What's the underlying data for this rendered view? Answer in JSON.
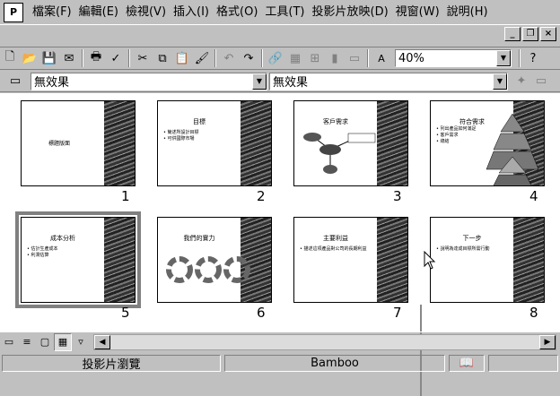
{
  "menubar": {
    "app_icon": "powerpoint-doc-icon",
    "items": [
      "檔案(F)",
      "編輯(E)",
      "檢視(V)",
      "插入(I)",
      "格式(O)",
      "工具(T)",
      "投影片放映(D)",
      "視窗(W)",
      "說明(H)"
    ]
  },
  "toolbar": {
    "zoom_value": "40%"
  },
  "effects": {
    "slide_transition": "無效果",
    "text_effect": "無效果"
  },
  "slides": [
    {
      "number": "1",
      "title": "",
      "body": [
        "標題版面"
      ],
      "footer": ""
    },
    {
      "number": "2",
      "title": "目標",
      "body": [
        "• 簡述所設計目標",
        "• 可供國際市場"
      ],
      "footer": ""
    },
    {
      "number": "3",
      "title": "客戶需求",
      "body": [],
      "footer": ""
    },
    {
      "number": "4",
      "title": "符合需求",
      "body": [
        "• 列出產品如何滿足",
        "• 客戶需求",
        "• 總結"
      ],
      "footer": ""
    },
    {
      "number": "5",
      "title": "成本分析",
      "body": [
        "• 估計生產成本",
        "• 利潤估算"
      ],
      "footer": ""
    },
    {
      "number": "6",
      "title": "我們的實力",
      "body": [],
      "footer": ""
    },
    {
      "number": "7",
      "title": "主要利益",
      "body": [
        "• 描述這項產品對公司的長期利益"
      ],
      "footer": ""
    },
    {
      "number": "8",
      "title": "下一步",
      "body": [
        "• 說明為達成目標所需行動"
      ],
      "footer": ""
    }
  ],
  "statusbar": {
    "view_name": "投影片瀏覽",
    "template": "Bamboo"
  }
}
